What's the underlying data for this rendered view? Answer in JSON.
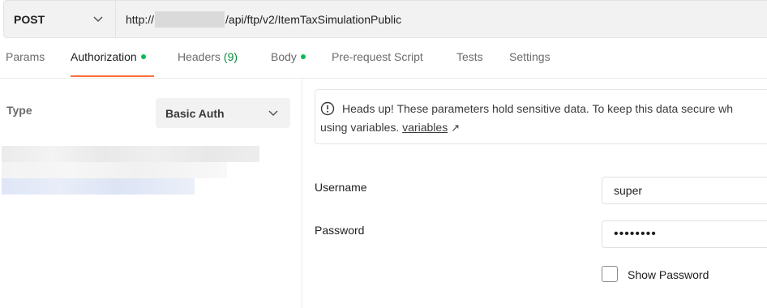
{
  "request": {
    "method": "POST",
    "url_prefix": "http://",
    "url_suffix": "/api/ftp/v2/ItemTaxSimulationPublic"
  },
  "tabs": [
    {
      "label": "Params"
    },
    {
      "label": "Authorization",
      "dot": true,
      "active": true
    },
    {
      "label": "Headers",
      "count": "(9)"
    },
    {
      "label": "Body",
      "dot": true
    },
    {
      "label": "Pre-request Script"
    },
    {
      "label": "Tests"
    },
    {
      "label": "Settings"
    }
  ],
  "auth": {
    "type_label": "Type",
    "type_value": "Basic Auth"
  },
  "notice": {
    "line1": "Heads up! These parameters hold sensitive data. To keep this data secure wh",
    "line2_prefix": "using variables.",
    "link": "variables",
    "link_arrow": "↗"
  },
  "form": {
    "username_label": "Username",
    "username_value": "super",
    "password_label": "Password",
    "password_value": "••••••••",
    "show_password_label": "Show Password",
    "show_password_checked": false
  },
  "colors": {
    "accent": "#ff6c37",
    "dot": "#0cbb52",
    "count": "#0a8a3e"
  },
  "icons": {
    "chevron": "chevron-down-icon",
    "info": "info-icon",
    "external": "external-link-icon"
  }
}
